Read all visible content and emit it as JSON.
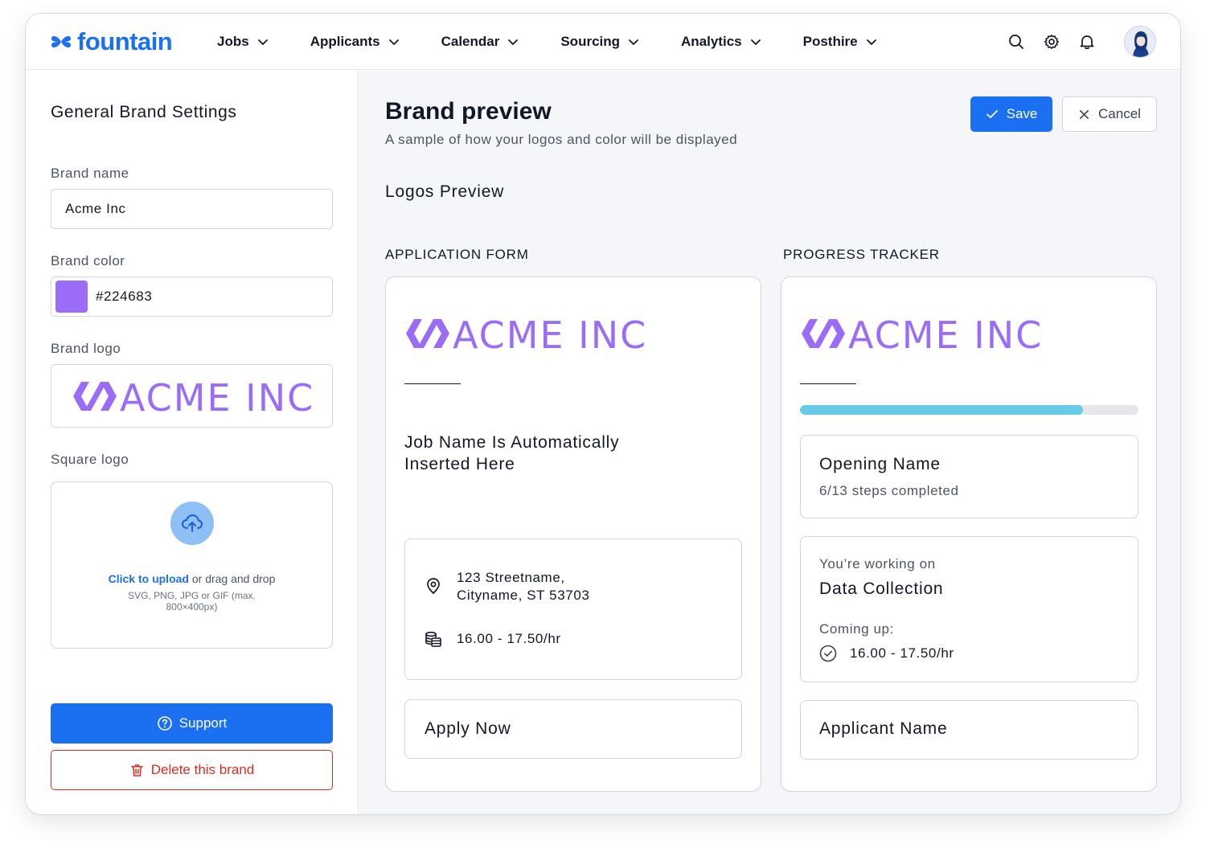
{
  "app": {
    "brand_word": "fountain",
    "brand_color": "#1b6ff1"
  },
  "nav": {
    "items": [
      {
        "label": "Jobs"
      },
      {
        "label": "Applicants"
      },
      {
        "label": "Calendar"
      },
      {
        "label": "Sourcing"
      },
      {
        "label": "Analytics"
      },
      {
        "label": "Posthire"
      }
    ],
    "icons": [
      "search-icon",
      "gear-icon",
      "bell-icon",
      "avatar"
    ]
  },
  "settings": {
    "title": "General Brand Settings",
    "brand_name_label": "Brand name",
    "brand_name_value": "Acme Inc",
    "brand_color_label": "Brand color",
    "brand_color_value": "#224683",
    "swatch_color": "#9b6cf7",
    "brand_logo_label": "Brand logo",
    "logo_text": "ACME INC",
    "square_logo_label": "Square logo",
    "upload_link": "Click to upload",
    "upload_rest": " or drag and drop",
    "upload_hint": "SVG, PNG, JPG or GIF (max. 800×400px)",
    "support_label": "Support",
    "delete_label": "Delete this brand"
  },
  "preview": {
    "title": "Brand preview",
    "subtitle": "A sample of how your logos and color will be displayed",
    "save_label": "Save",
    "cancel_label": "Cancel",
    "logos_preview_label": "Logos Preview",
    "application_form": {
      "label": "APPLICATION FORM",
      "logo_text": "ACME INC",
      "job_name": "Job Name Is Automatically Inserted Here",
      "address_line1": "123 Streetname,",
      "address_line2": "Cityname, ST 53703",
      "pay": "16.00 - 17.50/hr",
      "apply_label": "Apply Now"
    },
    "progress_tracker": {
      "label": "PROGRESS TRACKER",
      "logo_text": "ACME INC",
      "progress_fraction": 0.835,
      "opening_name": "Opening Name",
      "steps": "6/13 steps completed",
      "working_on_label": "You’re working on",
      "working_on": "Data Collection",
      "coming_up_label": "Coming up:",
      "coming_up_value": "16.00 - 17.50/hr",
      "applicant_name": "Applicant Name"
    }
  }
}
